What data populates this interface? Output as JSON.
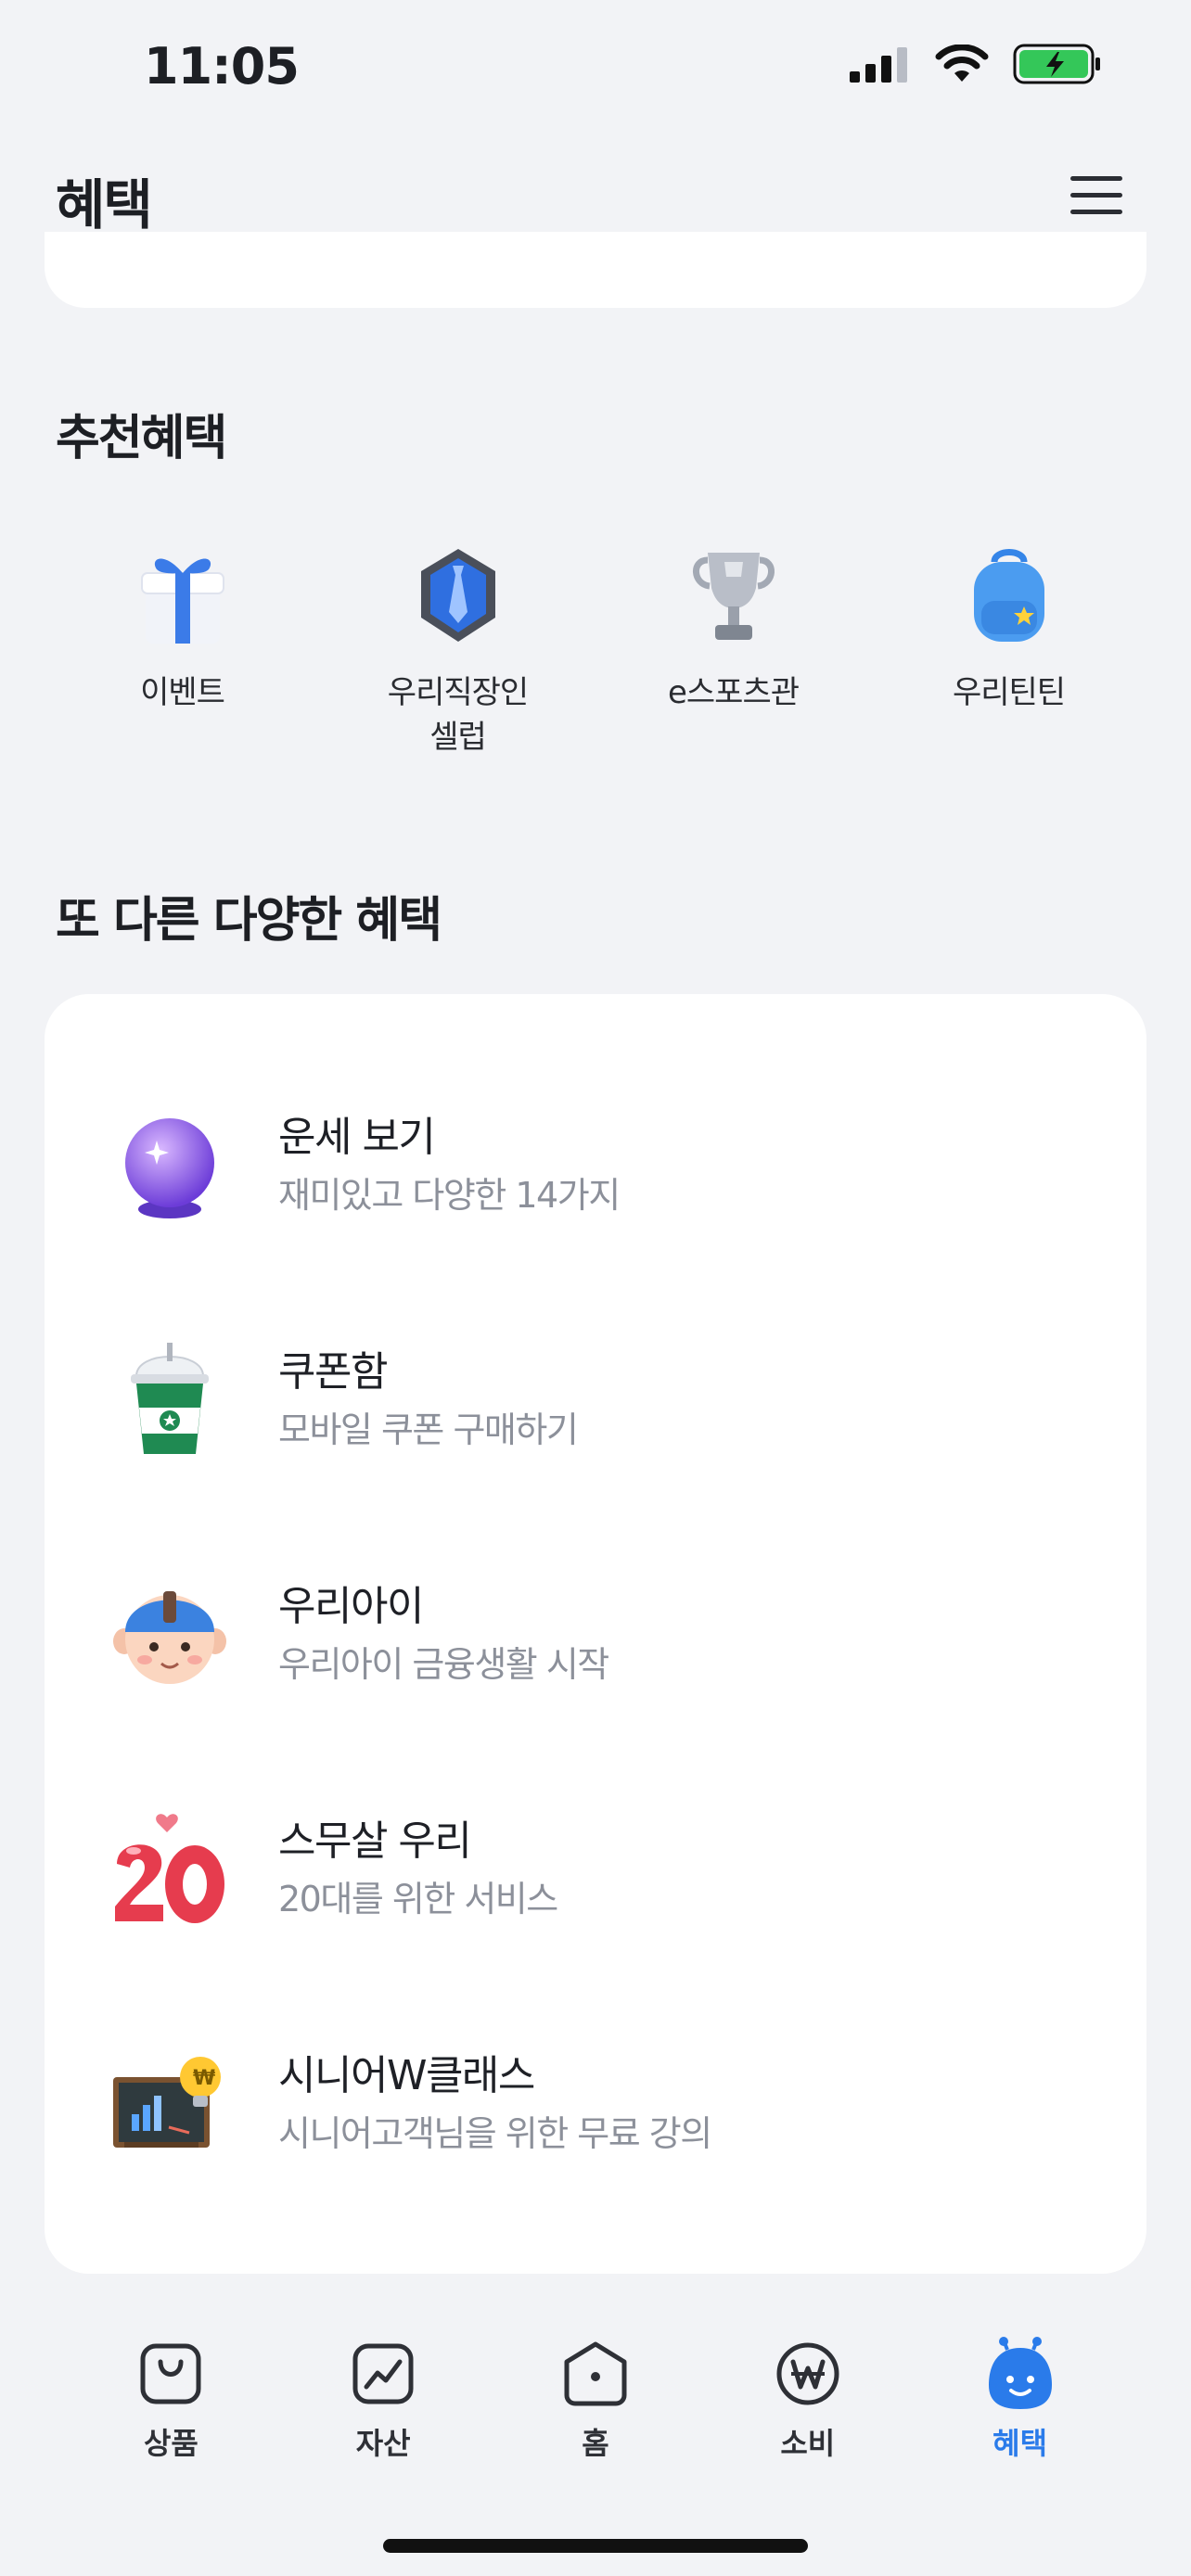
{
  "status_bar": {
    "time": "11:05"
  },
  "header": {
    "title": "혜택"
  },
  "recommended": {
    "title": "추천혜택",
    "items": [
      {
        "label": "이벤트",
        "icon": "gift-icon"
      },
      {
        "label": "우리직장인\n셀럽",
        "icon": "shield-tie-icon"
      },
      {
        "label": "e스포츠관",
        "icon": "trophy-icon"
      },
      {
        "label": "우리틴틴",
        "icon": "backpack-icon"
      }
    ]
  },
  "other": {
    "title": "또 다른 다양한 혜택",
    "items": [
      {
        "title": "운세 보기",
        "subtitle": "재미있고 다양한 14가지",
        "icon": "crystal-ball-icon"
      },
      {
        "title": "쿠폰함",
        "subtitle": "모바일 쿠폰 구매하기",
        "icon": "coffee-cup-icon"
      },
      {
        "title": "우리아이",
        "subtitle": "우리아이 금융생활 시작",
        "icon": "child-face-icon"
      },
      {
        "title": "스무살 우리",
        "subtitle": "20대를 위한 서비스",
        "icon": "twenty-heart-icon"
      },
      {
        "title": "시니어W클래스",
        "subtitle": "시니어고객님을 위한 무료 강의",
        "icon": "blackboard-bulb-icon"
      }
    ]
  },
  "bottom_nav": {
    "items": [
      {
        "label": "상품",
        "icon": "shopping-bag-icon",
        "active": false
      },
      {
        "label": "자산",
        "icon": "chart-icon",
        "active": false
      },
      {
        "label": "홈",
        "icon": "home-icon",
        "active": false
      },
      {
        "label": "소비",
        "icon": "won-icon",
        "active": false
      },
      {
        "label": "혜택",
        "icon": "mascot-icon",
        "active": true
      }
    ]
  },
  "colors": {
    "accent": "#2a7bea",
    "background": "#f2f3f6",
    "subtext": "#8c909a"
  }
}
